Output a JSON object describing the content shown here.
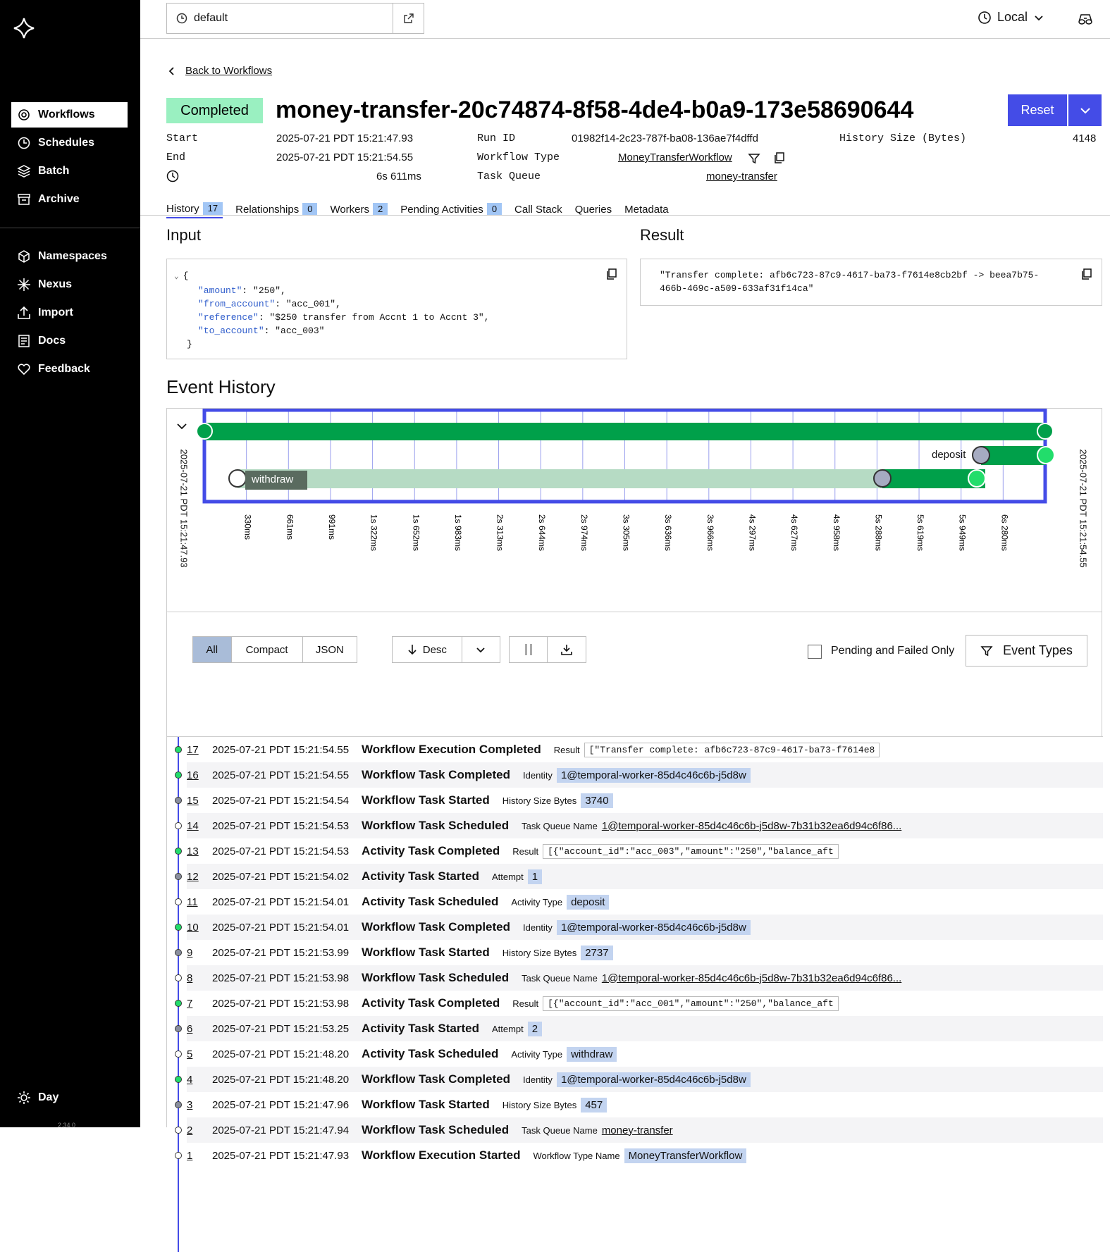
{
  "sidebar": {
    "nav": [
      {
        "label": "Workflows",
        "icon": "workflows-icon"
      },
      {
        "label": "Schedules",
        "icon": "schedules-icon"
      },
      {
        "label": "Batch",
        "icon": "batch-icon"
      },
      {
        "label": "Archive",
        "icon": "archive-icon"
      },
      {
        "label": "Namespaces",
        "icon": "namespaces-icon"
      },
      {
        "label": "Nexus",
        "icon": "nexus-icon"
      },
      {
        "label": "Import",
        "icon": "import-icon"
      },
      {
        "label": "Docs",
        "icon": "docs-icon"
      },
      {
        "label": "Feedback",
        "icon": "feedback-icon"
      }
    ],
    "theme_label": "Day",
    "version": "2.34.0"
  },
  "topbar": {
    "namespace": "default",
    "timezone": "Local"
  },
  "header": {
    "back_label": "Back to Workflows",
    "status": "Completed",
    "workflow_id": "money-transfer-20c74874-8f58-4de4-b0a9-173e58690644",
    "reset_label": "Reset",
    "start_label": "Start",
    "start_value": "2025-07-21 PDT 15:21:47.93",
    "end_label": "End",
    "end_value": "2025-07-21 PDT 15:21:54.55",
    "duration": "6s 611ms",
    "run_id_label": "Run ID",
    "run_id": "01982f14-2c23-787f-ba08-136ae7f4dffd",
    "workflow_type_label": "Workflow Type",
    "workflow_type": "MoneyTransferWorkflow",
    "task_queue_label": "Task Queue",
    "task_queue": "money-transfer",
    "history_size_label": "History Size (Bytes)",
    "history_size": "4148"
  },
  "tabs": [
    {
      "label": "History",
      "count": "17"
    },
    {
      "label": "Relationships",
      "count": "0"
    },
    {
      "label": "Workers",
      "count": "2"
    },
    {
      "label": "Pending Activities",
      "count": "0"
    },
    {
      "label": "Call Stack",
      "count": null
    },
    {
      "label": "Queries",
      "count": null
    },
    {
      "label": "Metadata",
      "count": null
    }
  ],
  "input": {
    "title": "Input",
    "open": "{",
    "close": "}",
    "lines": [
      {
        "key": "\"amount\"",
        "value": ": \"250\","
      },
      {
        "key": "\"from_account\"",
        "value": ": \"acc_001\","
      },
      {
        "key": "\"reference\"",
        "value": ": \"$250 transfer from Accnt 1 to Accnt 3\","
      },
      {
        "key": "\"to_account\"",
        "value": ": \"acc_003\""
      }
    ]
  },
  "result": {
    "title": "Result",
    "line1": "\"Transfer complete: afb6c723-87c9-4617-ba73-f7614e8cb2bf -> beea7b75-",
    "line2": "466b-469c-a509-633af31f14ca\""
  },
  "event_history": {
    "title": "Event History",
    "timeline": {
      "start_label": "2025-07-21 PDT 15:21:47.93",
      "end_label": "2025-07-21 PDT 15:21:54.55",
      "ticks": [
        "330ms",
        "661ms",
        "991ms",
        "1s 322ms",
        "1s 652ms",
        "1s 983ms",
        "2s 313ms",
        "2s 644ms",
        "2s 974ms",
        "3s 305ms",
        "3s 636ms",
        "3s 966ms",
        "4s 297ms",
        "4s 627ms",
        "4s 958ms",
        "5s 288ms",
        "5s 619ms",
        "5s 949ms",
        "6s 280ms"
      ],
      "withdraw_label": "withdraw",
      "deposit_label": "deposit"
    },
    "view_modes": [
      "All",
      "Compact",
      "JSON"
    ],
    "sort_label": "Desc",
    "pending_label": "Pending and Failed Only",
    "event_types_label": "Event Types",
    "events": [
      {
        "id": "17",
        "time": "2025-07-21 PDT 15:21:54.55",
        "name": "Workflow Execution Completed",
        "key": "Result",
        "value": "[\"Transfer complete: afb6c723-87c9-4617-ba73-f7614e8",
        "style": "code",
        "dot": "green"
      },
      {
        "id": "16",
        "time": "2025-07-21 PDT 15:21:54.55",
        "name": "Workflow Task Completed",
        "key": "Identity",
        "value": "1@temporal-worker-85d4c46c6b-j5d8w",
        "style": "badge",
        "dot": "green"
      },
      {
        "id": "15",
        "time": "2025-07-21 PDT 15:21:54.54",
        "name": "Workflow Task Started",
        "key": "History Size Bytes",
        "value": "3740",
        "style": "badge",
        "dot": "gray"
      },
      {
        "id": "14",
        "time": "2025-07-21 PDT 15:21:54.53",
        "name": "Workflow Task Scheduled",
        "key": "Task Queue Name",
        "value": "1@temporal-worker-85d4c46c6b-j5d8w-7b31b32ea6d94c6f86...",
        "style": "link",
        "dot": "white"
      },
      {
        "id": "13",
        "time": "2025-07-21 PDT 15:21:54.53",
        "name": "Activity Task Completed",
        "key": "Result",
        "value": "[{\"account_id\":\"acc_003\",\"amount\":\"250\",\"balance_aft",
        "style": "code",
        "dot": "green"
      },
      {
        "id": "12",
        "time": "2025-07-21 PDT 15:21:54.02",
        "name": "Activity Task Started",
        "key": "Attempt",
        "value": "1",
        "style": "badge",
        "dot": "gray"
      },
      {
        "id": "11",
        "time": "2025-07-21 PDT 15:21:54.01",
        "name": "Activity Task Scheduled",
        "key": "Activity Type",
        "value": "deposit",
        "style": "badge",
        "dot": "white"
      },
      {
        "id": "10",
        "time": "2025-07-21 PDT 15:21:54.01",
        "name": "Workflow Task Completed",
        "key": "Identity",
        "value": "1@temporal-worker-85d4c46c6b-j5d8w",
        "style": "badge",
        "dot": "green"
      },
      {
        "id": "9",
        "time": "2025-07-21 PDT 15:21:53.99",
        "name": "Workflow Task Started",
        "key": "History Size Bytes",
        "value": "2737",
        "style": "badge",
        "dot": "gray"
      },
      {
        "id": "8",
        "time": "2025-07-21 PDT 15:21:53.98",
        "name": "Workflow Task Scheduled",
        "key": "Task Queue Name",
        "value": "1@temporal-worker-85d4c46c6b-j5d8w-7b31b32ea6d94c6f86...",
        "style": "link",
        "dot": "white"
      },
      {
        "id": "7",
        "time": "2025-07-21 PDT 15:21:53.98",
        "name": "Activity Task Completed",
        "key": "Result",
        "value": "[{\"account_id\":\"acc_001\",\"amount\":\"250\",\"balance_aft",
        "style": "code",
        "dot": "green"
      },
      {
        "id": "6",
        "time": "2025-07-21 PDT 15:21:53.25",
        "name": "Activity Task Started",
        "key": "Attempt",
        "value": "2",
        "style": "badge",
        "dot": "gray"
      },
      {
        "id": "5",
        "time": "2025-07-21 PDT 15:21:48.20",
        "name": "Activity Task Scheduled",
        "key": "Activity Type",
        "value": "withdraw",
        "style": "badge",
        "dot": "white"
      },
      {
        "id": "4",
        "time": "2025-07-21 PDT 15:21:48.20",
        "name": "Workflow Task Completed",
        "key": "Identity",
        "value": "1@temporal-worker-85d4c46c6b-j5d8w",
        "style": "badge",
        "dot": "green"
      },
      {
        "id": "3",
        "time": "2025-07-21 PDT 15:21:47.96",
        "name": "Workflow Task Started",
        "key": "History Size Bytes",
        "value": "457",
        "style": "badge",
        "dot": "gray"
      },
      {
        "id": "2",
        "time": "2025-07-21 PDT 15:21:47.94",
        "name": "Workflow Task Scheduled",
        "key": "Task Queue Name",
        "value": "money-transfer",
        "style": "link",
        "dot": "white"
      },
      {
        "id": "1",
        "time": "2025-07-21 PDT 15:21:47.93",
        "name": "Workflow Execution Started",
        "key": "Workflow Type Name",
        "value": "MoneyTransferWorkflow",
        "style": "badge",
        "dot": "white"
      }
    ]
  },
  "colors": {
    "accent": "#444ce7",
    "green": "#00a04a",
    "green_light": "#b6dbc4",
    "badge_green": "#9af0c1",
    "tag_blue": "#c3d4f0"
  }
}
